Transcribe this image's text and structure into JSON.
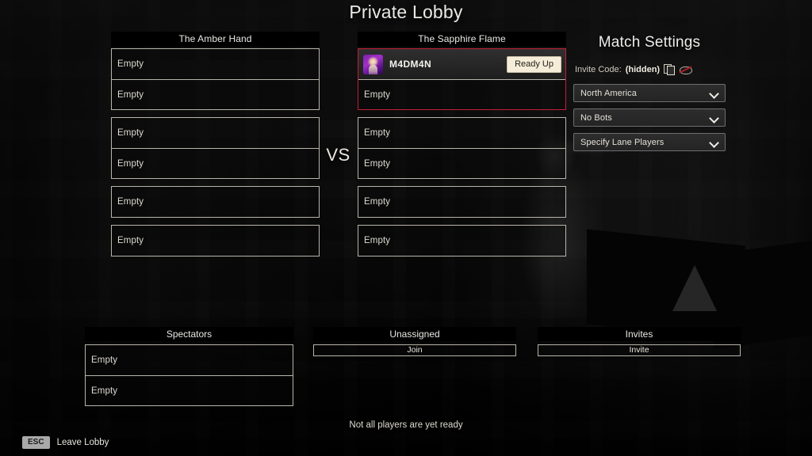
{
  "page_title": "Private Lobby",
  "vs_label": "VS",
  "teams": [
    {
      "name": "The Amber Hand",
      "groups": [
        {
          "slots": [
            {
              "state": "empty",
              "label": "Empty"
            },
            {
              "state": "empty",
              "label": "Empty"
            }
          ]
        },
        {
          "slots": [
            {
              "state": "empty",
              "label": "Empty"
            },
            {
              "state": "empty",
              "label": "Empty"
            }
          ]
        },
        {
          "slots": [
            {
              "state": "empty",
              "label": "Empty"
            }
          ]
        },
        {
          "slots": [
            {
              "state": "empty",
              "label": "Empty"
            }
          ]
        }
      ]
    },
    {
      "name": "The Sapphire Flame",
      "groups": [
        {
          "highlighted": true,
          "slots": [
            {
              "state": "player",
              "player_name": "M4DM4N",
              "ready_button": "Ready Up"
            },
            {
              "state": "empty",
              "label": "Empty"
            }
          ]
        },
        {
          "slots": [
            {
              "state": "empty",
              "label": "Empty"
            },
            {
              "state": "empty",
              "label": "Empty"
            }
          ]
        },
        {
          "slots": [
            {
              "state": "empty",
              "label": "Empty"
            }
          ]
        },
        {
          "slots": [
            {
              "state": "empty",
              "label": "Empty"
            }
          ]
        }
      ]
    }
  ],
  "match_settings": {
    "title": "Match Settings",
    "invite_code_label": "Invite Code:",
    "invite_code_value": "(hidden)",
    "copy_icon": "copy-icon",
    "reveal_icon": "eye-slash-icon",
    "dropdowns": [
      {
        "value": "North America"
      },
      {
        "value": "No Bots"
      },
      {
        "value": "Specify Lane Players"
      }
    ]
  },
  "spectators": {
    "title": "Spectators",
    "slots": [
      {
        "label": "Empty"
      },
      {
        "label": "Empty"
      }
    ]
  },
  "unassigned": {
    "title": "Unassigned",
    "join_label": "Join"
  },
  "invites": {
    "title": "Invites",
    "invite_label": "Invite"
  },
  "footer": {
    "status_text": "Not all players are yet ready",
    "esc_key": "ESC",
    "leave_lobby_label": "Leave Lobby"
  },
  "colors": {
    "accent_red": "#c2203a",
    "ready_button_bg": "#f6edd9",
    "border": "#b9b5ab",
    "text": "#e8e8e4"
  }
}
